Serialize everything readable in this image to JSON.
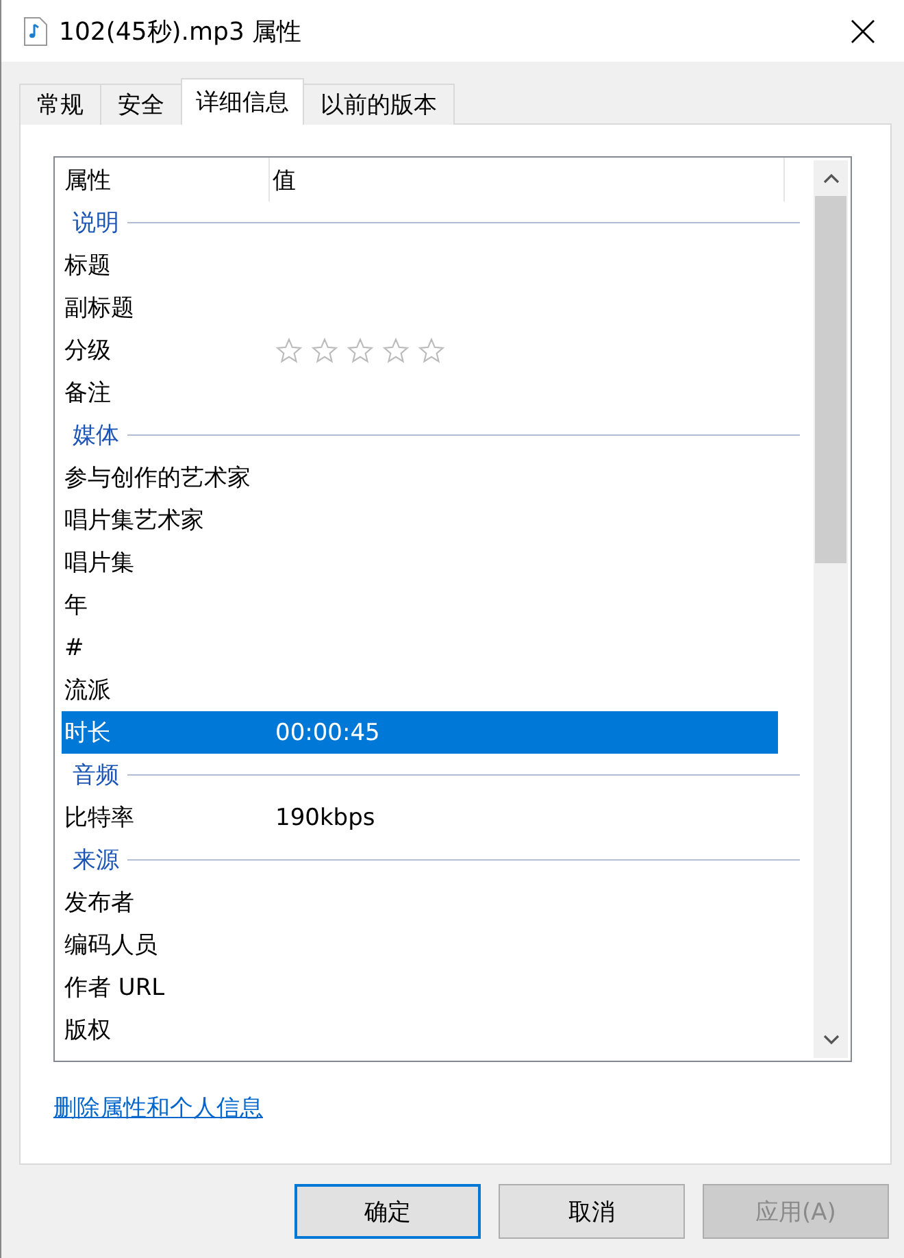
{
  "window": {
    "title": "102(45秒).mp3 属性"
  },
  "tabs": [
    {
      "label": "常规",
      "selected": false
    },
    {
      "label": "安全",
      "selected": false
    },
    {
      "label": "详细信息",
      "selected": true
    },
    {
      "label": "以前的版本",
      "selected": false
    }
  ],
  "table": {
    "columns": [
      "属性",
      "值"
    ],
    "rows": [
      {
        "kind": "section",
        "name": "说明"
      },
      {
        "kind": "property",
        "name": "标题",
        "selected": false
      },
      {
        "kind": "property",
        "name": "副标题",
        "selected": false
      },
      {
        "kind": "rating",
        "name": "分级",
        "stars": 0,
        "selected": false
      },
      {
        "kind": "property",
        "name": "备注",
        "selected": false
      },
      {
        "kind": "section",
        "name": "媒体"
      },
      {
        "kind": "property",
        "name": "参与创作的艺术家",
        "selected": false
      },
      {
        "kind": "property",
        "name": "唱片集艺术家",
        "selected": false
      },
      {
        "kind": "property",
        "name": "唱片集",
        "selected": false
      },
      {
        "kind": "property",
        "name": "年",
        "selected": false
      },
      {
        "kind": "property",
        "name": "#",
        "selected": false
      },
      {
        "kind": "property",
        "name": "流派",
        "selected": false
      },
      {
        "kind": "property",
        "name": "时长",
        "value": "00:00:45",
        "selected": true
      },
      {
        "kind": "section",
        "name": "音频"
      },
      {
        "kind": "property",
        "name": "比特率",
        "value": "190kbps",
        "selected": false
      },
      {
        "kind": "section",
        "name": "来源"
      },
      {
        "kind": "property",
        "name": "发布者",
        "selected": false
      },
      {
        "kind": "property",
        "name": "编码人员",
        "selected": false
      },
      {
        "kind": "property",
        "name": "作者 URL",
        "selected": false
      },
      {
        "kind": "property",
        "name": "版权",
        "selected": false
      }
    ]
  },
  "link": "删除属性和个人信息",
  "buttons": [
    {
      "label": "确定",
      "default": true,
      "disabled": false
    },
    {
      "label": "取消",
      "default": false,
      "disabled": false
    },
    {
      "label": "应用(A)",
      "default": false,
      "disabled": true
    }
  ]
}
